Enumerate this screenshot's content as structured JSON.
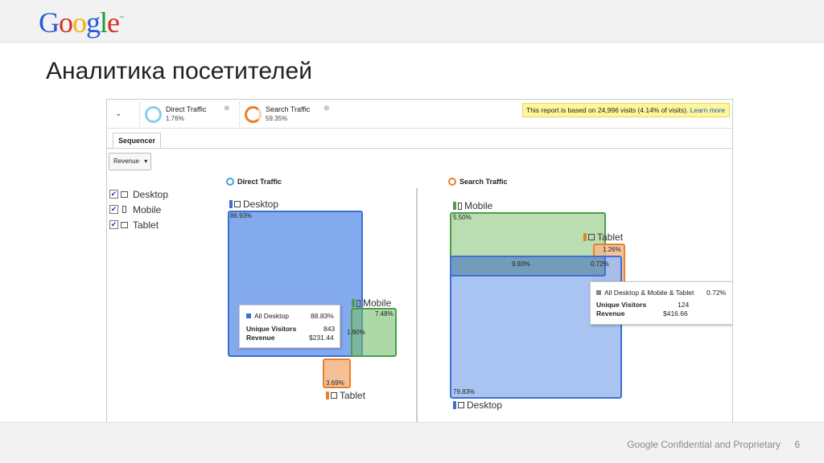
{
  "header": {
    "logo": "Google",
    "tm": "™"
  },
  "slide_title": "Аналитика посетителей",
  "footer": {
    "confidential": "Google Confidential and Proprietary",
    "page_number": "6"
  },
  "segments": [
    {
      "name": "Direct Traffic",
      "pct": "1.76%"
    },
    {
      "name": "Search Traffic",
      "pct": "59.35%"
    }
  ],
  "notice": {
    "text": "This report is based on 24,996 visits (4.14% of visits). ",
    "link": "Learn more"
  },
  "tab": "Sequencer",
  "dropdown": "Revenue",
  "checkboxes": [
    "Desktop",
    "Mobile",
    "Tablet"
  ],
  "direct": {
    "title": "Direct Traffic",
    "desktop_label": "Desktop",
    "desktop_pct": "86.93%",
    "mobile_label": "Mobile",
    "mobile_pct": "7.48%",
    "overlap_pct": "1.90%",
    "tablet_label": "Tablet",
    "tablet_pct": "3.69%",
    "tooltip": {
      "title": "All Desktop",
      "title_pct": "88.83%",
      "uv_label": "Unique Visitors",
      "uv": "843",
      "rev_label": "Revenue",
      "rev": "$231.44"
    }
  },
  "search": {
    "title": "Search Traffic",
    "mobile_label": "Mobile",
    "mobile_pct": "5.50%",
    "tablet_label": "Tablet",
    "tablet_pct": "1.26%",
    "overlap_pct": "9.93%",
    "overlap2_pct": "0.72%",
    "desktop_label": "Desktop",
    "desktop_pct": "79.83%",
    "tooltip": {
      "title": "All Desktop & Mobile & Tablet",
      "title_pct": "0.72%",
      "uv_label": "Unique Visitors",
      "uv": "124",
      "rev_label": "Revenue",
      "rev": "$416.66"
    }
  },
  "colors": {
    "desktop": "#3d6fd6",
    "mobile": "#4aa04a",
    "tablet": "#e8802a",
    "direct_ring": "#3fa7e0",
    "search_ring": "#e8802a"
  }
}
